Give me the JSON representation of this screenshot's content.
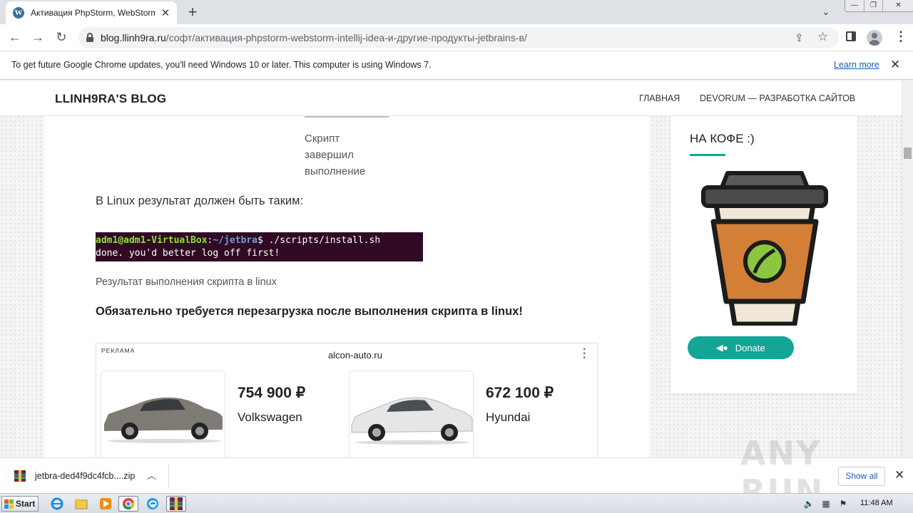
{
  "browser": {
    "tab_title": "Активация PhpStorm, WebStorm, IntelliJ IDEA",
    "tab_favicon": "W",
    "url_host": "blog.llinh9ra.ru",
    "url_path": "/софт/активация-phpstorm-webstorm-intellij-idea-и-другие-продукты-jetbrains-в/",
    "icons": [
      "back-icon",
      "forward-icon",
      "reload-icon",
      "lock-icon",
      "share-icon",
      "star-icon",
      "side-panel-icon",
      "profile-icon",
      "menu-icon"
    ]
  },
  "infobar": {
    "text": "To get future Google Chrome updates, you'll need Windows 10 or later. This computer is using Windows 7.",
    "link": "Learn more"
  },
  "site": {
    "title": "LLINH9RA'S BLOG",
    "nav": [
      "ГЛАВНАЯ",
      "DEVORUM — РАЗРАБОТКА САЙТОВ"
    ]
  },
  "article": {
    "script_caption_lines": [
      "Скрипт",
      "завершил",
      "выполнение"
    ],
    "linux_text": "В Linux результат должен быть таким:",
    "terminal": {
      "user": "adm1@adm1-VirtualBox",
      "colon": ":",
      "path": "~/jetbra",
      "prompt": "$ ./scripts/install.sh",
      "output": "done. you'd better log off first!"
    },
    "terminal_caption": "Результат выполнения скрипта в linux",
    "reboot_text": "Обязательно требуется перезагрузка после выполнения скрипта в linux!"
  },
  "ad": {
    "label": "РЕКЛАМА",
    "domain": "alcon-auto.ru",
    "items": [
      {
        "price": "754 900 ₽",
        "model": "Volkswagen",
        "color": "#7d7b74"
      },
      {
        "price": "672 100 ₽",
        "model": "Hyundai",
        "color": "#e4e6e8"
      }
    ]
  },
  "sidebar": {
    "title": "НА КОФЕ :)",
    "donate_label": "Donate",
    "accent": "#13a596"
  },
  "downloads": {
    "filename": "jetbra-ded4f9dc4fcb....zip",
    "show_all": "Show all"
  },
  "watermark": "ANY RUN",
  "taskbar": {
    "start_label": "Start",
    "clock": "11:48 AM"
  }
}
